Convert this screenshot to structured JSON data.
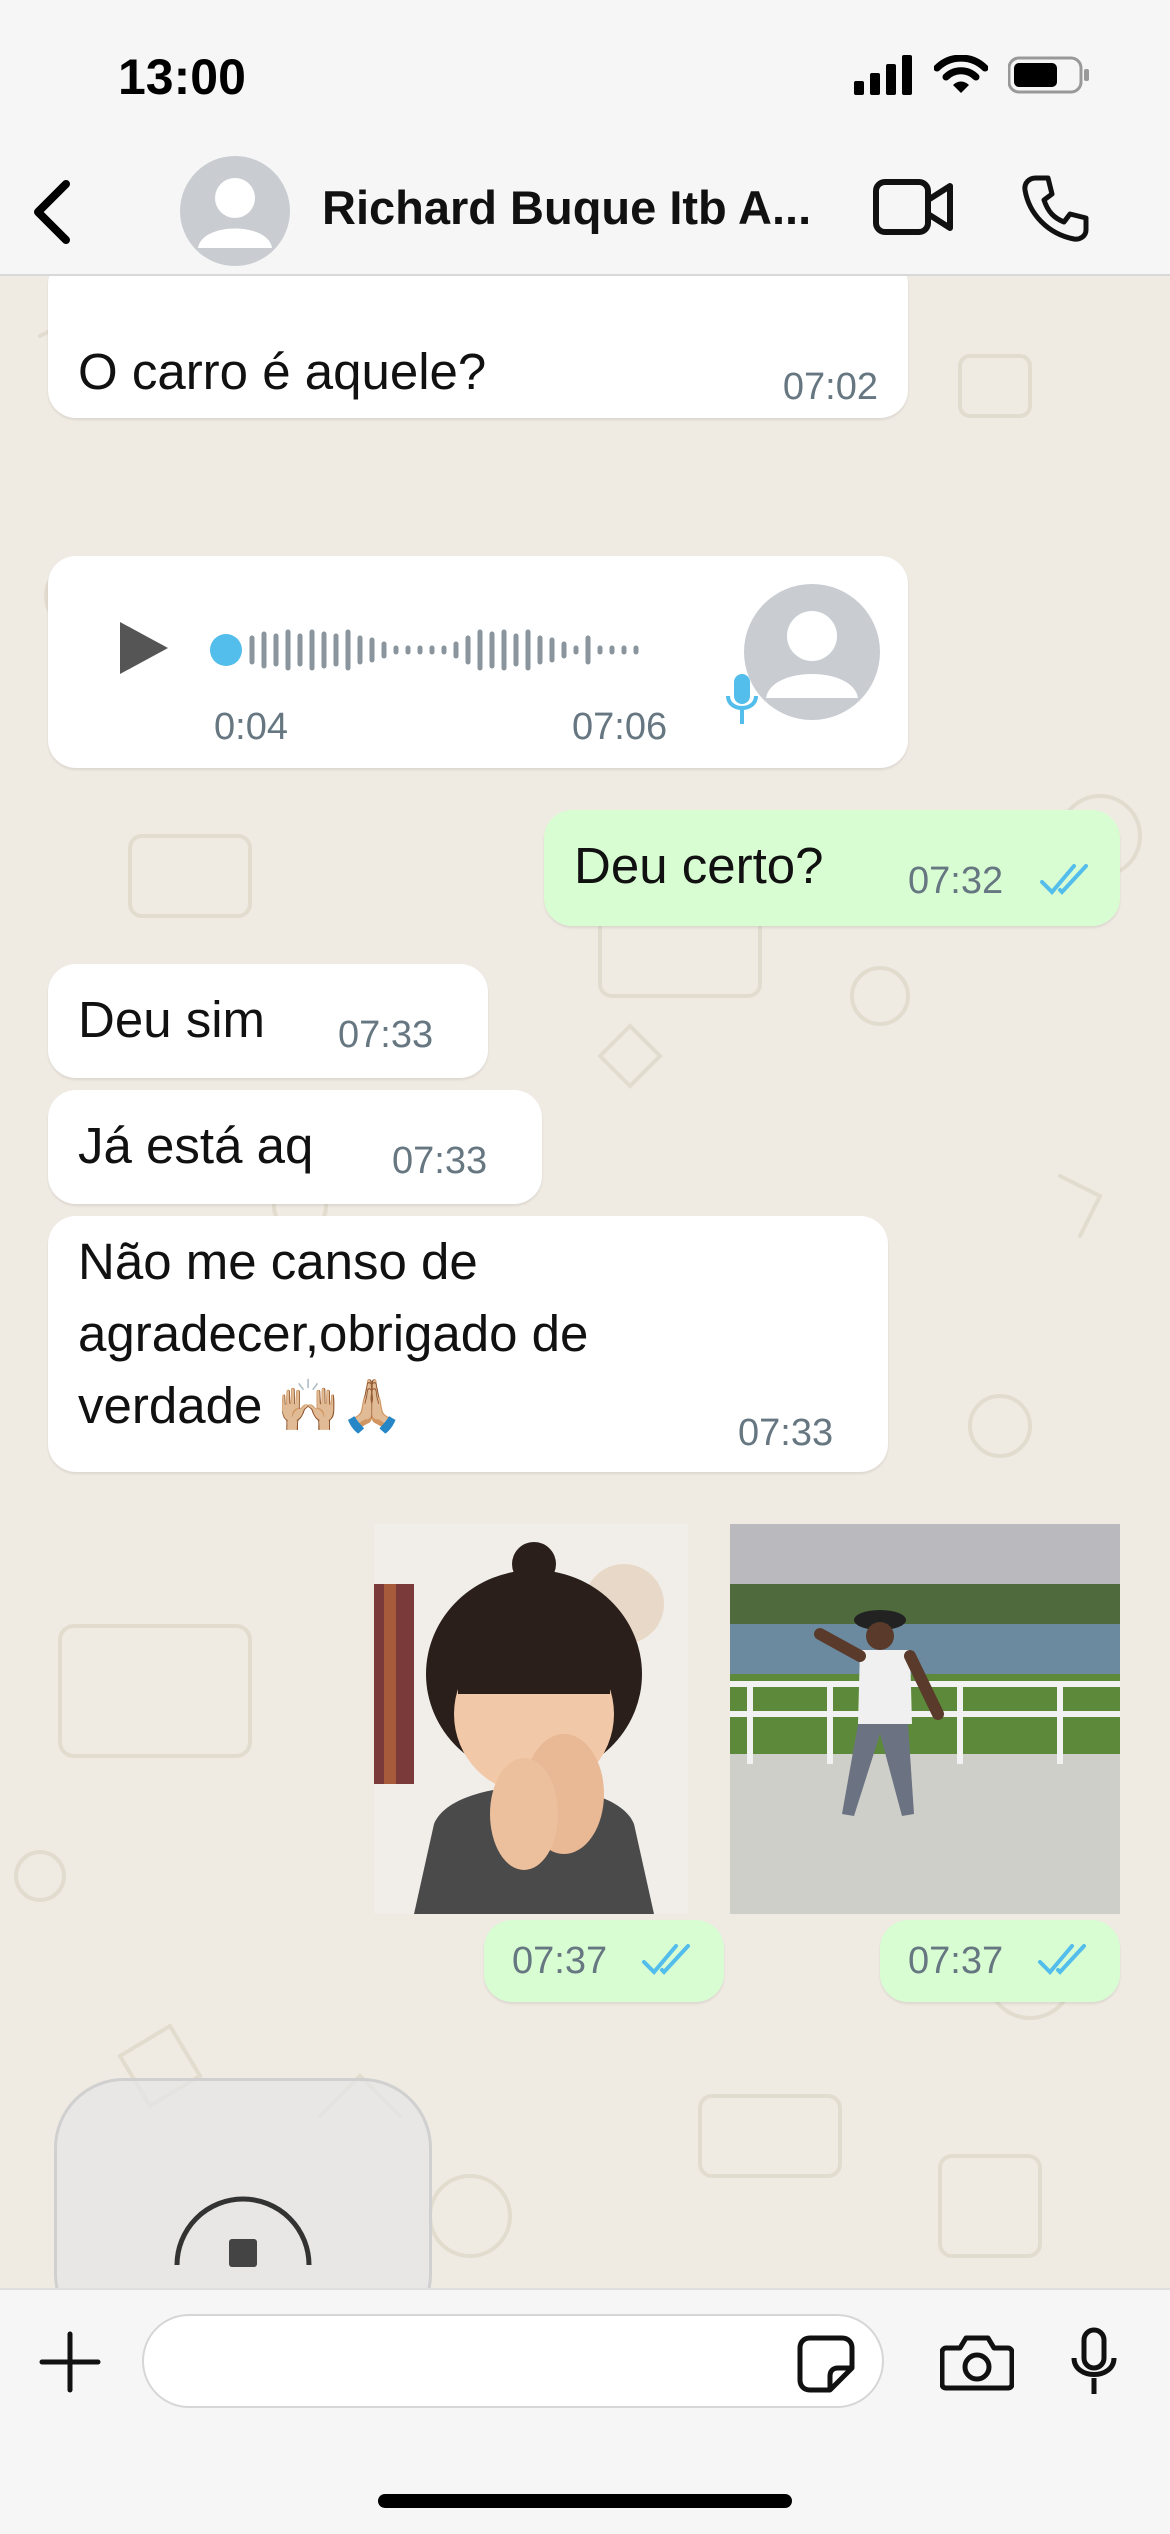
{
  "status_bar": {
    "time": "13:00",
    "battery_level": 0.7
  },
  "header": {
    "contact_name": "Richard Buque Itb A..."
  },
  "messages": [
    {
      "type": "text",
      "direction": "in",
      "text": "O carro é aquele?",
      "time": "07:02"
    },
    {
      "type": "voice",
      "direction": "in",
      "duration": "0:04",
      "time": "07:06",
      "progress": 0
    },
    {
      "type": "text",
      "direction": "out",
      "text": "Deu certo?",
      "time": "07:32",
      "status": "read"
    },
    {
      "type": "text",
      "direction": "in",
      "text": "Deu sim",
      "time": "07:33"
    },
    {
      "type": "text",
      "direction": "in",
      "text": "Já está aq",
      "time": "07:33"
    },
    {
      "type": "text",
      "direction": "in",
      "lines": [
        "Não me canso de",
        "agradecer,obrigado de",
        "verdade 🙌🏼🙏🏼"
      ],
      "time": "07:33"
    },
    {
      "type": "sticker",
      "direction": "out",
      "description_icon": "child-clapping-image",
      "time": "07:37",
      "status": "read"
    },
    {
      "type": "sticker",
      "direction": "out",
      "description_icon": "man-dancing-image",
      "time": "07:37",
      "status": "read"
    }
  ],
  "input": {
    "placeholder": ""
  },
  "colors": {
    "accent_blue": "#53bdeb",
    "outgoing_bubble": "#d9fdd3",
    "chat_bg": "#efeae2"
  }
}
